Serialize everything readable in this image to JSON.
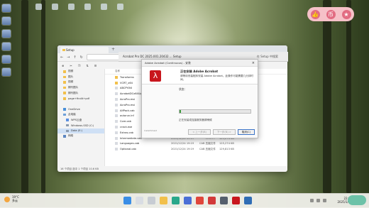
{
  "pill_icons": [
    "thumbs-up-icon",
    "coin-icon",
    "star-icon"
  ],
  "explorer": {
    "tab": "Setup",
    "sidebar": [
      {
        "label": "视频"
      },
      {
        "label": "图片"
      },
      {
        "label": "视频"
      },
      {
        "label": "期刊图片"
      },
      {
        "label": "期刊图片"
      },
      {
        "label": "page+findit+pdf"
      },
      {
        "label": ""
      },
      {
        "label": "OneDrive"
      },
      {
        "label": "此电脑"
      },
      {
        "label": "WPS云盘"
      },
      {
        "label": "Windows-SSD (C:)"
      },
      {
        "label": "Data (E:)"
      },
      {
        "label": "网络"
      }
    ],
    "column_name": "名称",
    "rows": [
      {
        "name": "Transforms",
        "date": "",
        "type": "",
        "size": ""
      },
      {
        "name": "VCRT_x64",
        "date": "",
        "type": "",
        "size": ""
      },
      {
        "name": "ABCPY.INI",
        "date": "",
        "type": "",
        "size": ""
      },
      {
        "name": "AcrobatDCx64Upgr",
        "date": "",
        "type": "",
        "size": ""
      },
      {
        "name": "AcroPro.msi",
        "date": "",
        "type": "",
        "size": ""
      },
      {
        "name": "AcroPro.msi",
        "date": "",
        "type": "",
        "size": ""
      },
      {
        "name": "AlfPack.cab",
        "date": "",
        "type": "",
        "size": ""
      },
      {
        "name": "autorun.inf",
        "date": "",
        "type": "",
        "size": ""
      },
      {
        "name": "Core.cab",
        "date": "",
        "type": "",
        "size": ""
      },
      {
        "name": "crack.exe",
        "date": "",
        "type": "",
        "size": ""
      },
      {
        "name": "Extras.cab",
        "date": "2021/12/24 19:19",
        "type": "CAB 压缩文件",
        "size": "63,822 KB"
      },
      {
        "name": "Intermediate.cab",
        "date": "2021/12/24 19:19",
        "type": "CAB 压缩文件",
        "size": "125,274 KB"
      },
      {
        "name": "Languages.cab",
        "date": "2021/12/24 19:19",
        "type": "CAB 压缩文件",
        "size": "125,274 KB"
      },
      {
        "name": "Optional.cab",
        "date": "2021/12/24 19:19",
        "type": "CAB 压缩文件",
        "size": "129,813 KB"
      }
    ],
    "status": "16 个项目    选中 1 个项目 10.6 KB"
  },
  "acrobat_bar": {
    "title": "Acrobat Pro DC 2025.001.20432 ... Setup",
    "right": "在 Setup 中搜索"
  },
  "installer": {
    "title": "Adobe Acrobat (Continuous) - 安装",
    "heading": "正在安装 Adobe Acrobat",
    "subheading": "请等待安装程序安装 Adobe Acrobat。此操作可能需要几分钟时间。",
    "status_label": "状态：",
    "progress": 0.02,
    "remaining": "正在安装或连接服务器请稍候",
    "brand": "InstallShield",
    "buttons": {
      "back": "< 上一步(B)",
      "next": "下一步(N) >",
      "cancel": "取消(C)"
    }
  },
  "taskbar": {
    "temp": "19°C",
    "weather": "多云",
    "time": "22:34",
    "date": "2025/1/18"
  }
}
